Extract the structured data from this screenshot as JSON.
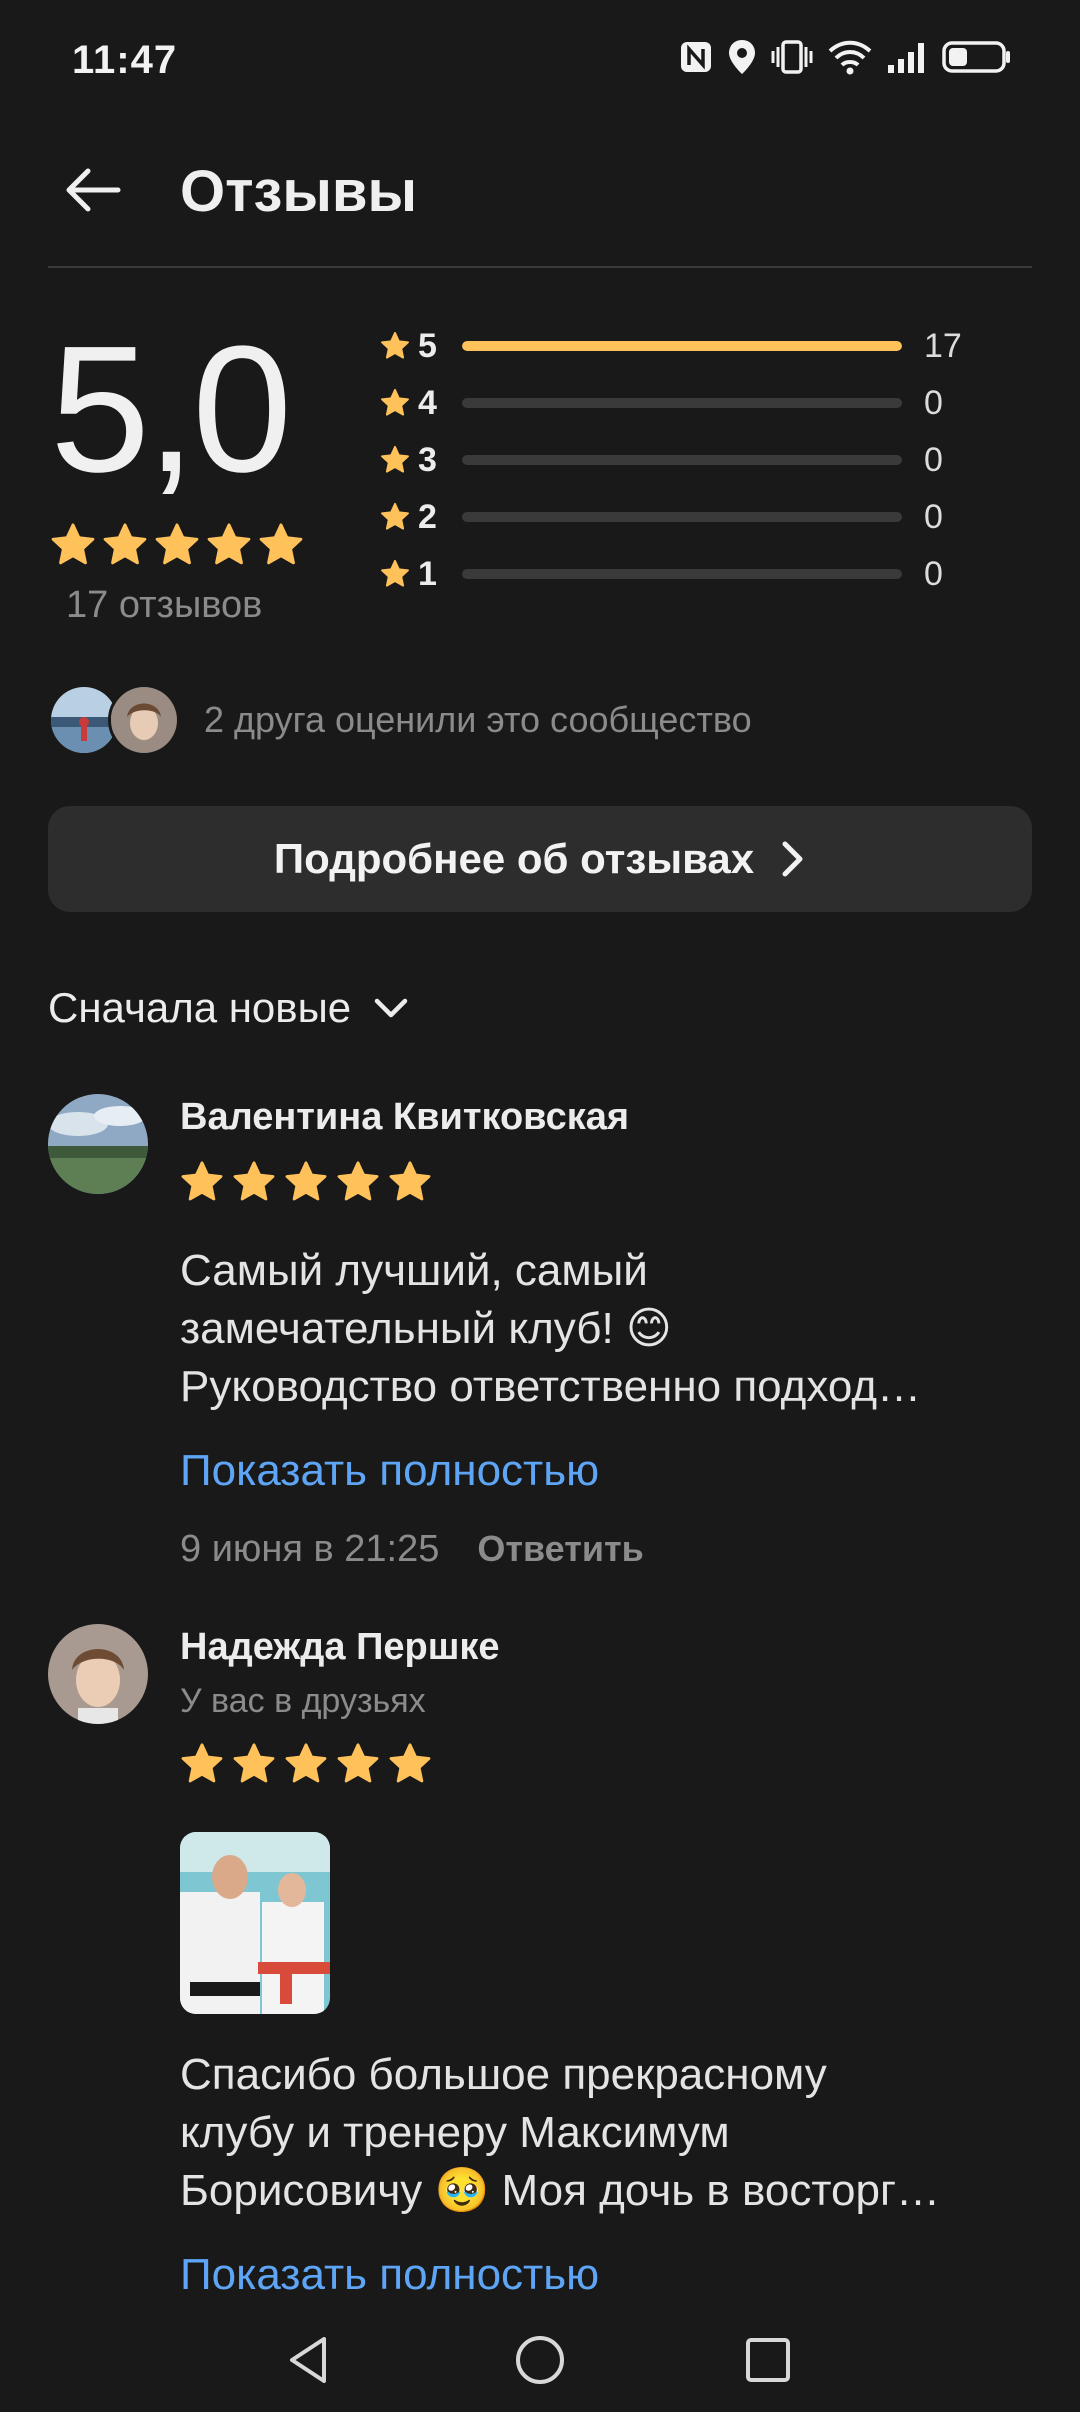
{
  "status_bar": {
    "time": "11:47",
    "battery_percent": 35
  },
  "header": {
    "title": "Отзывы"
  },
  "summary": {
    "score": "5,0",
    "stars": 5,
    "count_label": "17 отзывов",
    "distribution": [
      {
        "label": "5",
        "count": "17",
        "fraction": 1.0
      },
      {
        "label": "4",
        "count": "0",
        "fraction": 0
      },
      {
        "label": "3",
        "count": "0",
        "fraction": 0
      },
      {
        "label": "2",
        "count": "0",
        "fraction": 0
      },
      {
        "label": "1",
        "count": "0",
        "fraction": 0
      }
    ]
  },
  "friends": {
    "text": "2 друга оценили это сообщество"
  },
  "more_button": {
    "label": "Подробнее об отзывах"
  },
  "sort": {
    "label": "Сначала новые"
  },
  "reviews": [
    {
      "author": "Валентина Квитковская",
      "stars": 5,
      "text_lines": [
        "Самый лучший, самый",
        "замечательный клуб! 😊",
        "Руководство ответственно подход…"
      ],
      "show_more": "Показать полностью",
      "date": "9 июня в 21:25",
      "reply": "Ответить"
    },
    {
      "author": "Надежда Першке",
      "subtitle": "У вас в друзьях",
      "stars": 5,
      "text_lines": [
        "Спасибо большое прекрасному",
        "клубу и тренеру Максимум",
        "Борисовичу 🥹 Моя дочь в восторг…"
      ],
      "show_more": "Показать полностью"
    }
  ],
  "colors": {
    "accent_star": "#ffc15a",
    "link": "#5ea6f5",
    "background": "#191919",
    "button_bg": "#2d2d2d"
  },
  "icons": [
    "nfc-icon",
    "location-icon",
    "vibrate-icon",
    "wifi-icon",
    "signal-icon",
    "battery-icon",
    "back-arrow-icon",
    "star-icon",
    "chevron-right-icon",
    "chevron-down-icon",
    "nav-back-icon",
    "nav-home-icon",
    "nav-recents-icon"
  ]
}
